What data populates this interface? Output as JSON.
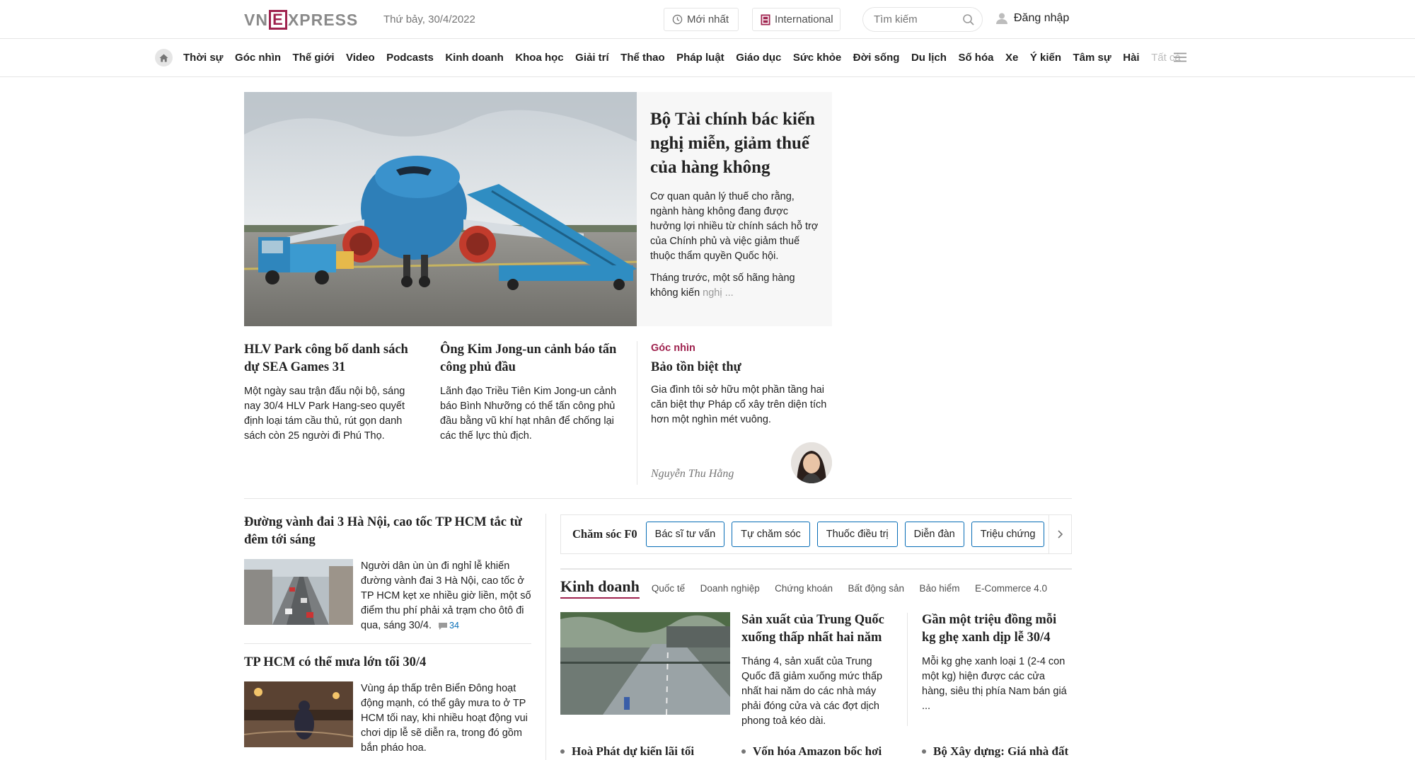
{
  "header": {
    "logo_left": "VN",
    "logo_e": "E",
    "logo_right": "XPRESS",
    "date": "Thứ bảy, 30/4/2022",
    "latest_label": "Mới nhất",
    "international_label": "International",
    "search_placeholder": "Tìm kiếm",
    "login_label": "Đăng nhập"
  },
  "nav": {
    "items": [
      "Thời sự",
      "Góc nhìn",
      "Thế giới",
      "Video",
      "Podcasts",
      "Kinh doanh",
      "Khoa học",
      "Giải trí",
      "Thể thao",
      "Pháp luật",
      "Giáo dục",
      "Sức khỏe",
      "Đời sống",
      "Du lịch",
      "Số hóa",
      "Xe",
      "Ý kiến",
      "Tâm sự",
      "Hài"
    ],
    "all_label": "Tất cả"
  },
  "hero": {
    "title": "Bộ Tài chính bác kiến nghị miễn, giảm thuế của hàng không",
    "desc": "Cơ quan quản lý thuế cho rằng, ngành hàng không đang được hưởng lợi nhiều từ chính sách hỗ trợ của Chính phủ và việc giảm thuế thuộc thẩm quyền Quốc hội.",
    "desc2_main": "Tháng trước, một số hãng hàng không kiến",
    "desc2_fade": "nghị ..."
  },
  "subs": [
    {
      "title": "HLV Park công bố danh sách dự SEA Games 31",
      "desc": "Một ngày sau trận đấu nội bộ, sáng nay 30/4 HLV Park Hang-seo quyết định loại tám cầu thủ, rút gọn danh sách còn 25 người đi Phú Thọ."
    },
    {
      "title": "Ông Kim Jong-un cảnh báo tấn công phủ đầu",
      "desc": "Lãnh đạo Triều Tiên Kim Jong-un cảnh báo Bình Nhưỡng có thể tấn công phủ đầu bằng vũ khí hạt nhân để chống lại các thế lực thù địch."
    }
  ],
  "gocnhin": {
    "label": "Góc nhìn",
    "title": "Bảo tồn biệt thự",
    "desc": "Gia đình tôi sở hữu một phần tầng hai căn biệt thự Pháp cổ xây trên diện tích hơn một nghìn mét vuông.",
    "author": "Nguyễn Thu Hằng"
  },
  "left_news": [
    {
      "title": "Đường vành đai 3 Hà Nội, cao tốc TP HCM tắc từ đêm tới sáng",
      "desc": "Người dân ùn ùn đi nghỉ lễ khiến đường vành đai 3 Hà Nội, cao tốc ở TP HCM kẹt xe nhiều giờ liền, một số điểm thu phí phải xả trạm cho ôtô đi qua, sáng 30/4.",
      "comments": "34"
    },
    {
      "title": "TP HCM có thể mưa lớn tối 30/4",
      "desc": "Vùng áp thấp trên Biển Đông hoạt động mạnh, có thể gây mưa to ở TP HCM tối nay, khi nhiều hoạt động vui chơi dịp lễ sẽ diễn ra, trong đó gồm bắn pháo hoa."
    }
  ],
  "f0": {
    "label": "Chăm sóc F0",
    "buttons": [
      "Bác sĩ tư vấn",
      "Tự chăm sóc",
      "Thuốc điều trị",
      "Diễn đàn",
      "Triệu chứng"
    ]
  },
  "business": {
    "title": "Kinh doanh",
    "tabs": [
      "Quốc tế",
      "Doanh nghiệp",
      "Chứng khoán",
      "Bất động sản",
      "Bảo hiểm",
      "E-Commerce 4.0"
    ],
    "articles": [
      {
        "title": "Sản xuất của Trung Quốc xuống thấp nhất hai năm",
        "desc": "Tháng 4, sản xuất của Trung Quốc đã giảm xuống mức thấp nhất hai năm do các nhà máy phải đóng cửa và các đợt dịch phong toả kéo dài."
      },
      {
        "title": "Gần một triệu đồng mỗi kg ghẹ xanh dịp lễ 30/4",
        "desc": "Mỗi kg ghẹ xanh loại 1 (2-4 con một kg) hiện được các cửa hàng, siêu thị phía Nam bán giá ..."
      }
    ],
    "bullets": [
      "Hoà Phát dự kiến lãi tối",
      "Vốn hóa Amazon bốc hơi",
      "Bộ Xây dựng: Giá nhà đất"
    ]
  },
  "colors": {
    "brand": "#9f224e",
    "link_blue": "#076db6",
    "muted": "#757575"
  }
}
